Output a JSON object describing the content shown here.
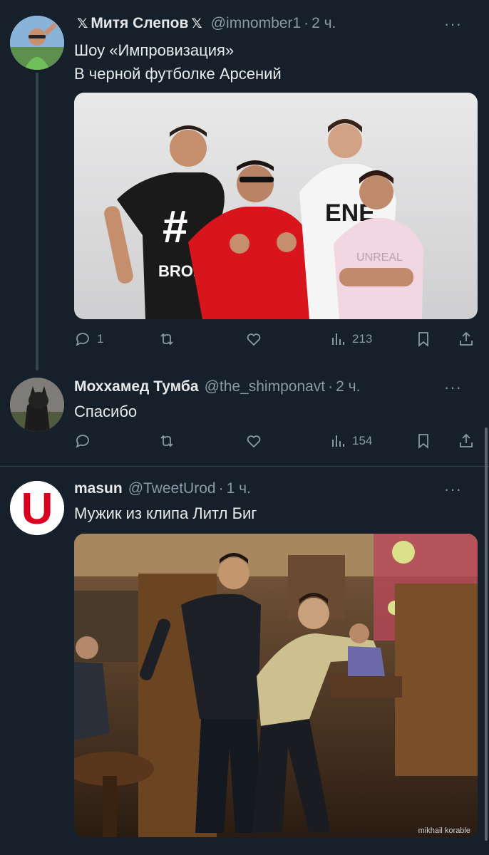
{
  "tweets": [
    {
      "name": "Митя Слепов",
      "x_prefix": "𝕏",
      "x_suffix": "𝕏",
      "handle": "@imnomber1",
      "dot": "·",
      "time": "2 ч.",
      "more": "···",
      "text_lines": [
        "Шоу «Импровизация»",
        "В черной футболке Арсений"
      ],
      "media_icons": [
        "#",
        "BRO.",
        "ENE",
        "UNREAL"
      ],
      "actions": {
        "reply": "1",
        "retweet": "",
        "like": "",
        "views": "213"
      }
    },
    {
      "name": "Мохxамед Тумба",
      "handle": "@the_shimponavt",
      "dot": "·",
      "time": "2 ч.",
      "more": "···",
      "text_lines": [
        "Спасибо"
      ],
      "actions": {
        "reply": "",
        "retweet": "",
        "like": "",
        "views": "154"
      }
    },
    {
      "name": "masun",
      "handle": "@TweetUrod",
      "dot": "·",
      "time": "1 ч.",
      "more": "···",
      "avatar_letter": "U",
      "text_lines": [
        "Мужик из клипа Литл Биг"
      ],
      "media_watermark": "mikhail korable"
    }
  ],
  "colors": {
    "background": "#15202b",
    "text": "#e7e9ea",
    "secondary": "#8b98a5",
    "divider": "#38444d",
    "brand_red": "#d9001d"
  },
  "icons": [
    "reply-icon",
    "retweet-icon",
    "like-icon",
    "views-icon",
    "bookmark-icon",
    "share-icon",
    "more-icon",
    "x-logo-icon"
  ]
}
